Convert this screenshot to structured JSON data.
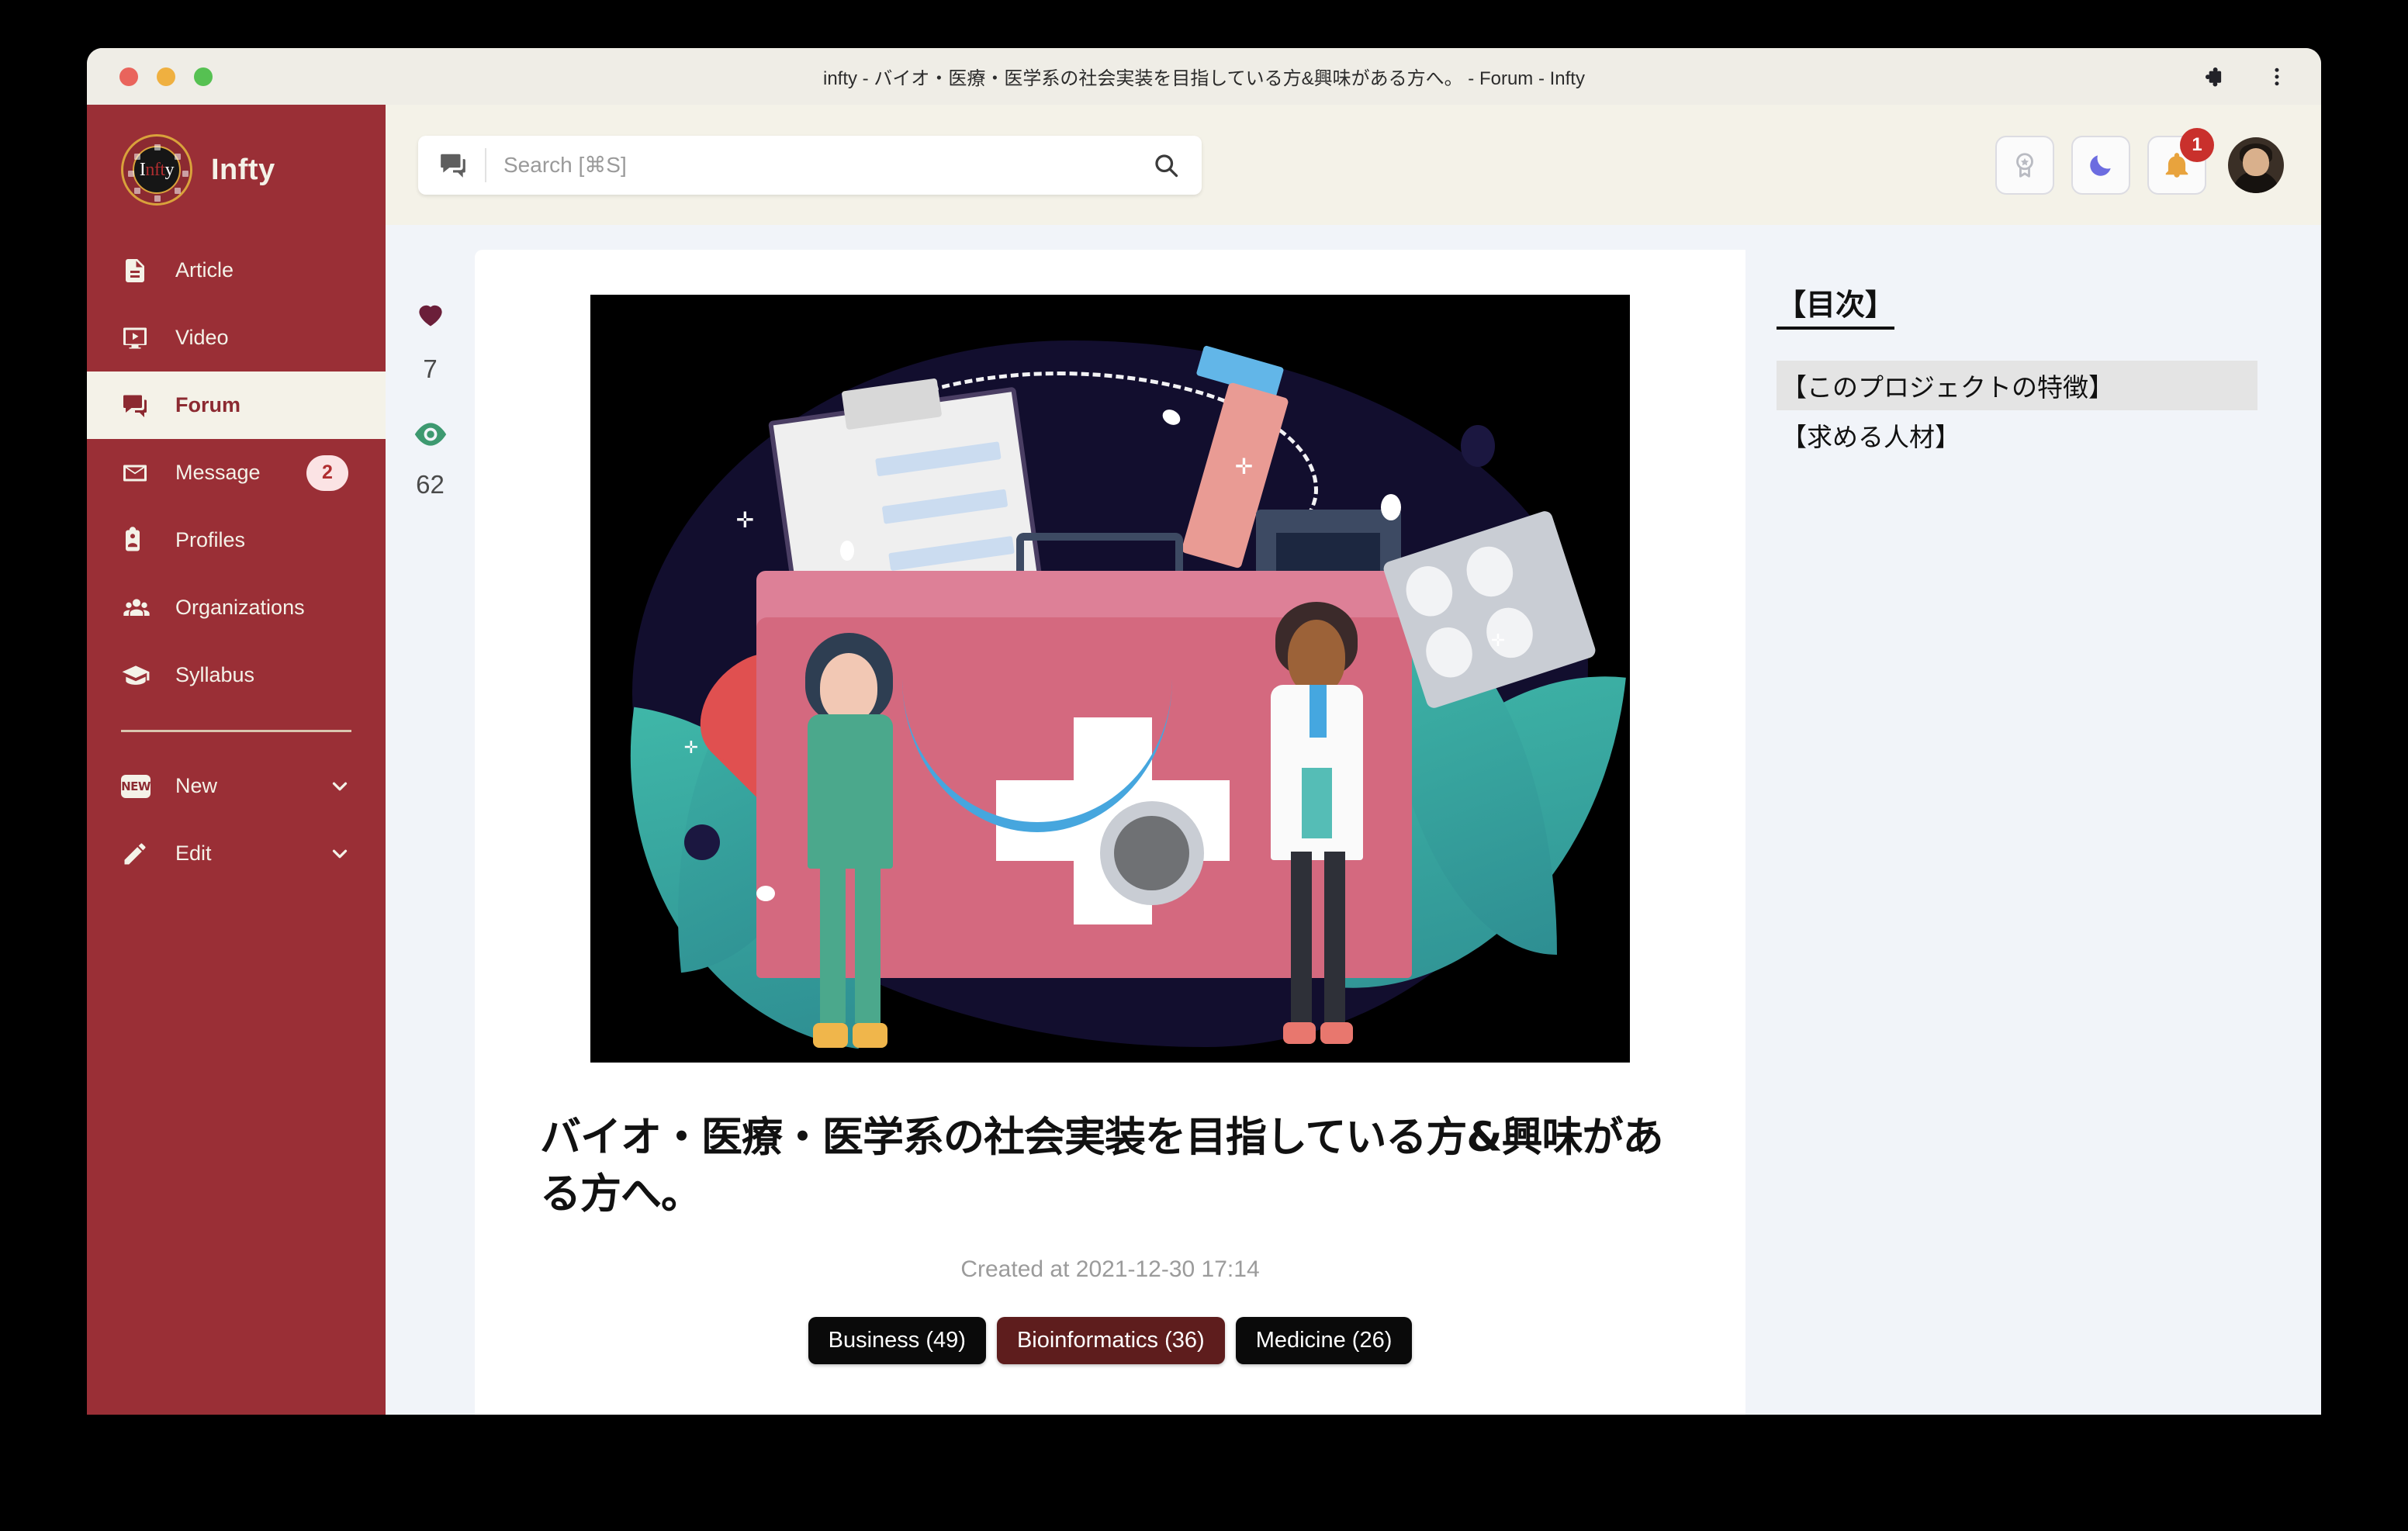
{
  "browser": {
    "tab_title": "infty - バイオ・医療・医学系の社会実装を目指している方&興味がある方へ。 - Forum - Infty",
    "extensions_icon": "puzzle-icon",
    "menu_icon": "three-dot-menu-icon"
  },
  "sidebar": {
    "brand_name": "Infty",
    "logo_text_1": "I",
    "logo_text_2": "nft",
    "logo_text_3": "y",
    "items": [
      {
        "label": "Article",
        "icon": "document-icon",
        "badge": "",
        "active": false
      },
      {
        "label": "Video",
        "icon": "video-icon",
        "badge": "",
        "active": false
      },
      {
        "label": "Forum",
        "icon": "forum-icon",
        "badge": "",
        "active": true
      },
      {
        "label": "Message",
        "icon": "envelope-icon",
        "badge": "2",
        "active": false
      },
      {
        "label": "Profiles",
        "icon": "id-card-icon",
        "badge": "",
        "active": false
      },
      {
        "label": "Organizations",
        "icon": "people-group-icon",
        "badge": "",
        "active": false
      },
      {
        "label": "Syllabus",
        "icon": "graduation-cap-icon",
        "badge": "",
        "active": false
      }
    ],
    "actions": [
      {
        "label": "New",
        "icon": "new-chip-icon",
        "chevron": "chevron-down-icon"
      },
      {
        "label": "Edit",
        "icon": "pencil-icon",
        "chevron": "chevron-down-icon"
      }
    ]
  },
  "topbar": {
    "search_placeholder": "Search [⌘S]",
    "search_value": "",
    "search_prefix_icon": "forum-icon",
    "search_submit_icon": "search-icon",
    "buttons": [
      {
        "icon": "badge-award-icon",
        "badge": ""
      },
      {
        "icon": "moon-icon",
        "badge": ""
      },
      {
        "icon": "bell-icon",
        "badge": "1"
      }
    ],
    "avatar": "user-avatar"
  },
  "stats": {
    "like_icon": "heart-icon",
    "like_count": "7",
    "view_icon": "eye-icon",
    "view_count": "62"
  },
  "article": {
    "hero_alt": "medical-illustration",
    "title": "バイオ・医療・医学系の社会実装を目指している方&興味がある方へ。",
    "created_at": "Created at 2021-12-30 17:14",
    "tags": [
      {
        "label": "Business (49)",
        "style": "black"
      },
      {
        "label": "Bioinformatics (36)",
        "style": "maroon"
      },
      {
        "label": "Medicine (26)",
        "style": "black"
      }
    ]
  },
  "toc": {
    "heading": "【目次】",
    "items": [
      {
        "label": "【このプロジェクトの特徴】",
        "highlight": true
      },
      {
        "label": "【求める人材】",
        "highlight": false
      }
    ]
  },
  "colors": {
    "sidebar": "#9A2F36",
    "cream": "#F4F2E8",
    "page_bg": "#F1F4F9",
    "accent_red": "#B02E30",
    "tag_maroon": "#5E1D1D",
    "notif_red": "#C9302C",
    "eye_green": "#3D9970",
    "heart_maroon": "#6B1F3A",
    "bell_orange": "#E8A33D",
    "moon_purple": "#6C6CE0"
  }
}
